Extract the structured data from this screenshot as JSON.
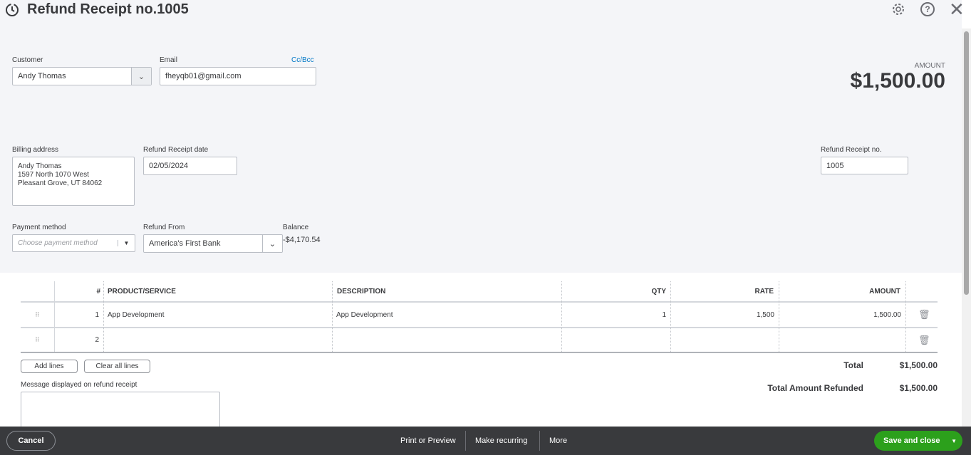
{
  "header": {
    "title": "Refund Receipt no.1005"
  },
  "customer": {
    "label": "Customer",
    "value": "Andy Thomas"
  },
  "email": {
    "label": "Email",
    "value": "fheyqb01@gmail.com",
    "ccbcc": "Cc/Bcc"
  },
  "amount": {
    "label": "AMOUNT",
    "value": "$1,500.00"
  },
  "billing": {
    "label": "Billing address",
    "lines": [
      "Andy Thomas",
      "1597 North 1070 West",
      "Pleasant Grove, UT  84062"
    ]
  },
  "date": {
    "label": "Refund Receipt date",
    "value": "02/05/2024"
  },
  "receipt_no": {
    "label": "Refund Receipt no.",
    "value": "1005"
  },
  "payment": {
    "label": "Payment method",
    "placeholder": "Choose payment method"
  },
  "refund_from": {
    "label": "Refund From",
    "value": "America's First Bank"
  },
  "balance": {
    "label": "Balance",
    "value": "-$4,170.54"
  },
  "table": {
    "headers": [
      "#",
      "PRODUCT/SERVICE",
      "DESCRIPTION",
      "QTY",
      "RATE",
      "AMOUNT"
    ],
    "rows": [
      {
        "n": "1",
        "product": "App Development",
        "description": "App Development",
        "qty": "1",
        "rate": "1,500",
        "amount": "1,500.00"
      },
      {
        "n": "2",
        "product": "",
        "description": "",
        "qty": "",
        "rate": "",
        "amount": ""
      }
    ]
  },
  "actions": {
    "add_lines": "Add lines",
    "clear_lines": "Clear all lines"
  },
  "message": {
    "label": "Message displayed on refund receipt"
  },
  "totals": {
    "total_label": "Total",
    "total": "$1,500.00",
    "refunded_label": "Total Amount Refunded",
    "refunded": "$1,500.00"
  },
  "footer": {
    "cancel": "Cancel",
    "print": "Print or Preview",
    "recurring": "Make recurring",
    "more": "More",
    "save": "Save and close"
  }
}
